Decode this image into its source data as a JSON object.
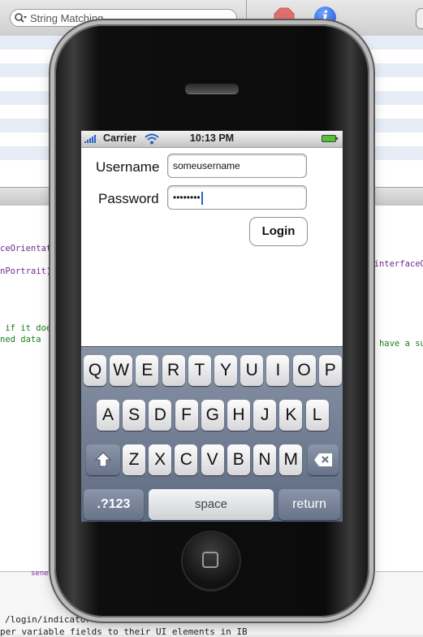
{
  "background_window": {
    "search": {
      "placeholder": "String Matching"
    },
    "info_icon": "i",
    "code_lines": [
      {
        "text": "ceOrientatio",
        "color": "purple"
      },
      {
        "text": "nPortrait);",
        "color": "purple"
      },
      {
        "text": "n)interfaceO",
        "color": "purple"
      },
      {
        "text": " if it doesn",
        "color": "green"
      },
      {
        "text": "ned data",
        "color": "green"
      },
      {
        "text": "'t have a su",
        "color": "green"
      }
    ],
    "bottom_lines": [
      "/login/indicator field to the testViewController",
      "per variable fields to their UI elements in IB"
    ],
    "bottom_fragment": "sene"
  },
  "status_bar": {
    "carrier": "Carrier",
    "time": "10:13 PM"
  },
  "form": {
    "username_label": "Username",
    "password_label": "Password",
    "username_value": "someusername",
    "password_value": "••••••••",
    "login_label": "Login"
  },
  "keyboard": {
    "row1": [
      "Q",
      "W",
      "E",
      "R",
      "T",
      "Y",
      "U",
      "I",
      "O",
      "P"
    ],
    "row2": [
      "A",
      "S",
      "D",
      "F",
      "G",
      "H",
      "J",
      "K",
      "L"
    ],
    "row3": [
      "Z",
      "X",
      "C",
      "V",
      "B",
      "N",
      "M"
    ],
    "numbers_label": ".?123",
    "space_label": "space",
    "return_label": "return"
  },
  "colors": {
    "accent": "#2a62c0",
    "battery": "#52c234",
    "stop": "#e04a4a"
  }
}
